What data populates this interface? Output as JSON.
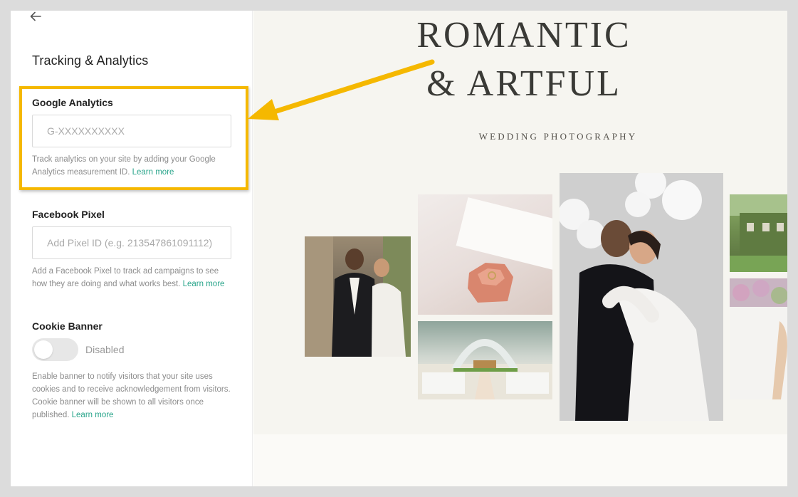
{
  "panel": {
    "title": "Tracking & Analytics",
    "back_icon": "arrow-left-icon"
  },
  "google_analytics": {
    "label": "Google Analytics",
    "value": "",
    "placeholder": "G-XXXXXXXXXX",
    "help_text": "Track analytics on your site by adding your Google Analytics measurement ID.",
    "link_text": "Learn more"
  },
  "facebook_pixel": {
    "label": "Facebook Pixel",
    "value": "",
    "placeholder": "Add Pixel ID (e.g. 213547861091112)",
    "help_text": "Add a Facebook Pixel to track ad campaigns to see how they are doing and what works best.",
    "link_text": "Learn more"
  },
  "cookie_banner": {
    "label": "Cookie Banner",
    "enabled": false,
    "state_text": "Disabled",
    "help_text": "Enable banner to notify visitors that your site uses cookies and to receive acknowledgement from visitors. Cookie banner will be shown to all visitors once published.",
    "link_text": "Learn more"
  },
  "preview": {
    "title_line1": "ROMANTIC",
    "title_line2": "& ARTFUL",
    "subtitle": "WEDDING PHOTOGRAPHY"
  },
  "colors": {
    "highlight": "#f5b800",
    "link": "#2aa58b",
    "preview_bg": "#f6f5f0"
  }
}
